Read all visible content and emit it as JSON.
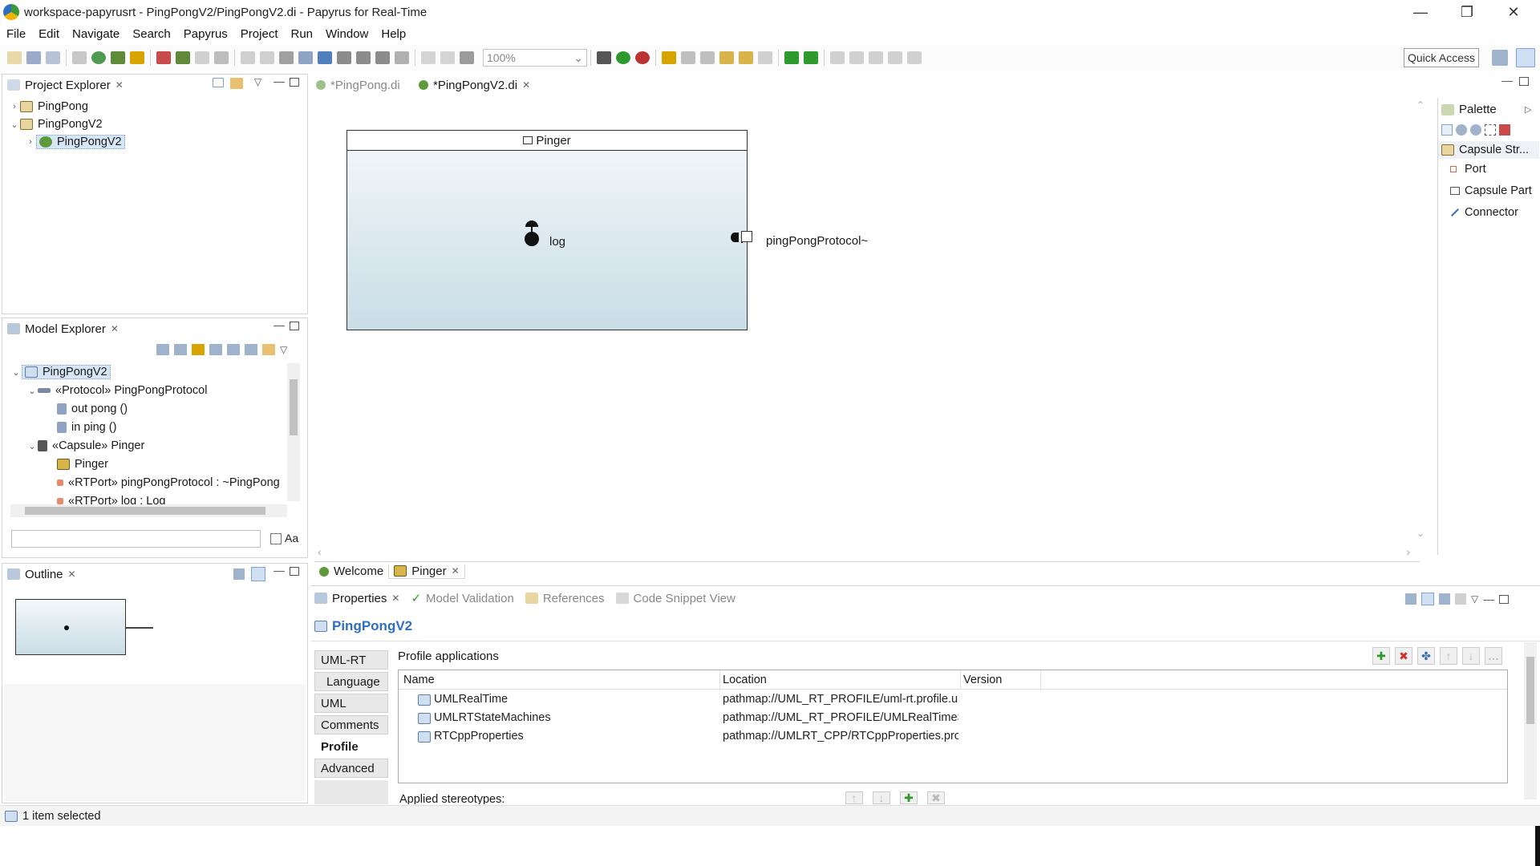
{
  "window": {
    "title": "workspace-papyrusrt - PingPongV2/PingPongV2.di - Papyrus for Real-Time",
    "controls": [
      "—",
      "❐",
      "✕"
    ]
  },
  "menu": [
    "File",
    "Edit",
    "Navigate",
    "Search",
    "Papyrus",
    "Project",
    "Run",
    "Window",
    "Help"
  ],
  "toolbar": {
    "zoom": "100%",
    "quick_access": "Quick Access"
  },
  "project_explorer": {
    "title": "Project Explorer",
    "items": [
      {
        "label": "PingPong",
        "expanded": false
      },
      {
        "label": "PingPongV2",
        "expanded": true
      },
      {
        "label": "PingPongV2",
        "expanded": false,
        "selected": true
      }
    ]
  },
  "model_explorer": {
    "title": "Model Explorer",
    "items": [
      {
        "label": "PingPongV2"
      },
      {
        "label": "«Protocol» PingPongProtocol"
      },
      {
        "label": "out pong ()"
      },
      {
        "label": "in ping ()"
      },
      {
        "label": "«Capsule» Pinger"
      },
      {
        "label": "Pinger"
      },
      {
        "label": "«RTPort» pingPongProtocol : ~PingPong"
      },
      {
        "label": "«RTPort» log : Log"
      }
    ],
    "filter_placeholder": "",
    "case_label": "Aa"
  },
  "outline": {
    "title": "Outline"
  },
  "editor": {
    "tabs": [
      {
        "label": "*PingPong.di",
        "active": false
      },
      {
        "label": "*PingPongV2.di",
        "active": true
      }
    ],
    "capsule_name": "Pinger",
    "port_log": "log",
    "port_protocol": "pingPongProtocol~",
    "bottom_tabs": [
      "Welcome",
      "Pinger"
    ]
  },
  "palette": {
    "title": "Palette",
    "drawer": "Capsule Str...",
    "items": [
      "Port",
      "Capsule Part",
      "Connector"
    ]
  },
  "properties": {
    "tabs_row": [
      "Properties",
      "Model Validation",
      "References",
      "Code Snippet View"
    ],
    "element": "PingPongV2",
    "side_tabs": [
      "UML-RT",
      "Language",
      "UML",
      "Comments",
      "Profile",
      "Advanced"
    ],
    "active_side_tab": "Profile",
    "section": "Profile applications",
    "columns": [
      "Name",
      "Location",
      "Version"
    ],
    "rows": [
      {
        "name": "UMLRealTime",
        "location": "pathmap://UML_RT_PROFILE/uml-rt.profile.u",
        "version": ""
      },
      {
        "name": "UMLRTStateMachines",
        "location": "pathmap://UML_RT_PROFILE/UMLRealTimeS",
        "version": ""
      },
      {
        "name": "RTCppProperties",
        "location": "pathmap://UMLRT_CPP/RTCppProperties.pro",
        "version": ""
      }
    ],
    "applied_stereotypes": "Applied stereotypes:"
  },
  "status": {
    "text": "1 item selected"
  },
  "colors": {
    "selection": "#d7e6f7",
    "capsule_top": "#f4f8fa",
    "capsule_bottom": "#c9dde6",
    "link_blue": "#2f6fc0"
  }
}
